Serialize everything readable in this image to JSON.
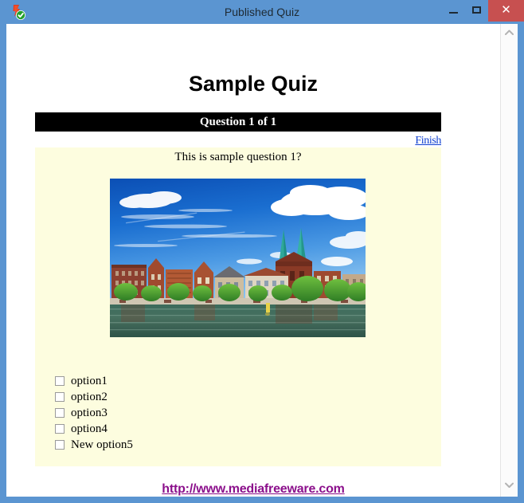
{
  "window": {
    "title": "Published Quiz",
    "icon": "quiz-app-icon",
    "controls": {
      "minimize": "–",
      "maximize": "□",
      "close": "✕"
    }
  },
  "quiz": {
    "heading": "Sample Quiz",
    "progress_bar": "Question 1 of 1",
    "finish_label": "Finish",
    "question_text": "This is sample question 1?",
    "image": {
      "name": "waterfront-city-photo",
      "description": "Photo of a European waterfront town with red brick buildings, twin green church spires, trees and a river under a blue sky with clouds"
    },
    "options": [
      {
        "label": "option1",
        "checked": false
      },
      {
        "label": "option2",
        "checked": false
      },
      {
        "label": "option3",
        "checked": false
      },
      {
        "label": "option4",
        "checked": false
      },
      {
        "label": "New option5",
        "checked": false
      }
    ]
  },
  "footer": {
    "link_text": "http://www.mediafreeware.com"
  },
  "scrollbar": {
    "up_arrow": "chevron-up",
    "down_arrow": "chevron-down"
  },
  "colors": {
    "titlebar": "#5b95d1",
    "close_button": "#c75050",
    "panel_background": "#fdfddf",
    "progress_bar_background": "#000000",
    "finish_link": "#1040d0",
    "footer_link": "#8b0f8b"
  }
}
